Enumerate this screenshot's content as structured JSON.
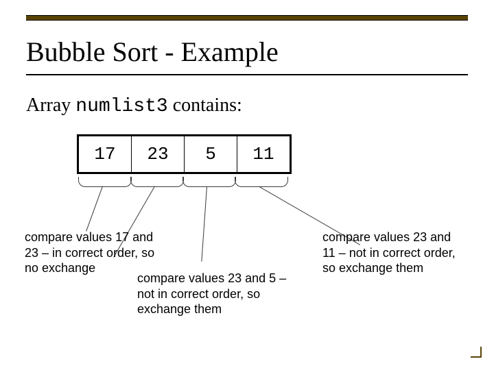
{
  "title": "Bubble Sort - Example",
  "array_label_prefix": "Array ",
  "array_name": "numlist3",
  "array_label_suffix": " contains:",
  "cells": {
    "c0": "17",
    "c1": "23",
    "c2": "5",
    "c3": "11"
  },
  "note1": "compare values 17 and 23 – in correct order, so no exchange",
  "note2": "compare values 23 and 5 – not in correct order, so exchange them",
  "note3": "compare values 23 and 11 – not in correct order, so exchange them"
}
